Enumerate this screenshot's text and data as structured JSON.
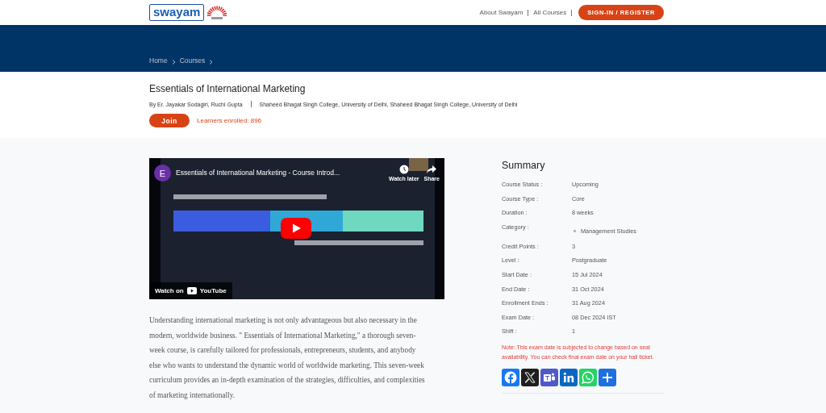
{
  "header": {
    "logo": "swayam",
    "nav": [
      "About Swayam",
      "All Courses"
    ],
    "sign_in": "SIGN-IN / REGISTER"
  },
  "breadcrumbs": [
    "Home",
    "Courses"
  ],
  "course": {
    "title": "Essentials of International Marketing",
    "instructors": "By Er. Jayakar Sodagiri, Ruchi Gupta",
    "institutions": "Shaheed Bhagat Singh College, University of Delhi, Shaheed Bhagat Singh College, University of Delhi",
    "join": "Join",
    "enrolled": "Learners enrolled: 896"
  },
  "video": {
    "channel_initial": "E",
    "title": "Essentials of International Marketing - Course Introd...",
    "watch_later": "Watch later",
    "share": "Share",
    "watch_on": "Watch on",
    "youtube": "YouTube"
  },
  "description": "Understanding international marketing is not only advantageous but also necessary in the modern, worldwide business. \" Essentials of International Marketing,\" a thorough seven-week course, is carefully tailored for professionals, entrepreneurs, students, and anybody else who wants to understand the dynamic world of worldwide marketing. This seven-week curriculum provides an in-depth examination of the strategies, difficulties, and complexities of marketing internationally.",
  "summary": {
    "title": "Summary",
    "rows": [
      {
        "kind": "text",
        "label": "Course Status :",
        "value": "Upcoming"
      },
      {
        "kind": "text",
        "label": "Course Type :",
        "value": "Core"
      },
      {
        "kind": "text",
        "label": "Duration :",
        "value": "8 weeks"
      },
      {
        "kind": "list",
        "label": "Category :",
        "value": "Management Studies"
      },
      {
        "kind": "text",
        "label": "Credit Points :",
        "value": "3"
      },
      {
        "kind": "text",
        "label": "Level :",
        "value": "Postgraduate"
      },
      {
        "kind": "text",
        "label": "Start Date :",
        "value": "15 Jul 2024"
      },
      {
        "kind": "text",
        "label": "End Date :",
        "value": "31 Oct 2024"
      },
      {
        "kind": "text",
        "label": "Enrollment Ends :",
        "value": "31 Aug 2024"
      },
      {
        "kind": "text",
        "label": "Exam Date :",
        "value": "08 Dec 2024 IST"
      },
      {
        "kind": "text",
        "label": "Shift :",
        "value": "1"
      }
    ],
    "note": "Note: This exam date is subjected to change based on seat availability. You can check final exam date on your hall ticket.",
    "share": [
      {
        "kind": "facebook",
        "color": "#1877f2"
      },
      {
        "kind": "x",
        "color": "#1f1f1f"
      },
      {
        "kind": "teams",
        "color": "#5059c9"
      },
      {
        "kind": "linkedin",
        "color": "#0a66c2"
      },
      {
        "kind": "whatsapp",
        "color": "#25d366"
      },
      {
        "kind": "more",
        "color": "#1e6fe0"
      }
    ]
  }
}
